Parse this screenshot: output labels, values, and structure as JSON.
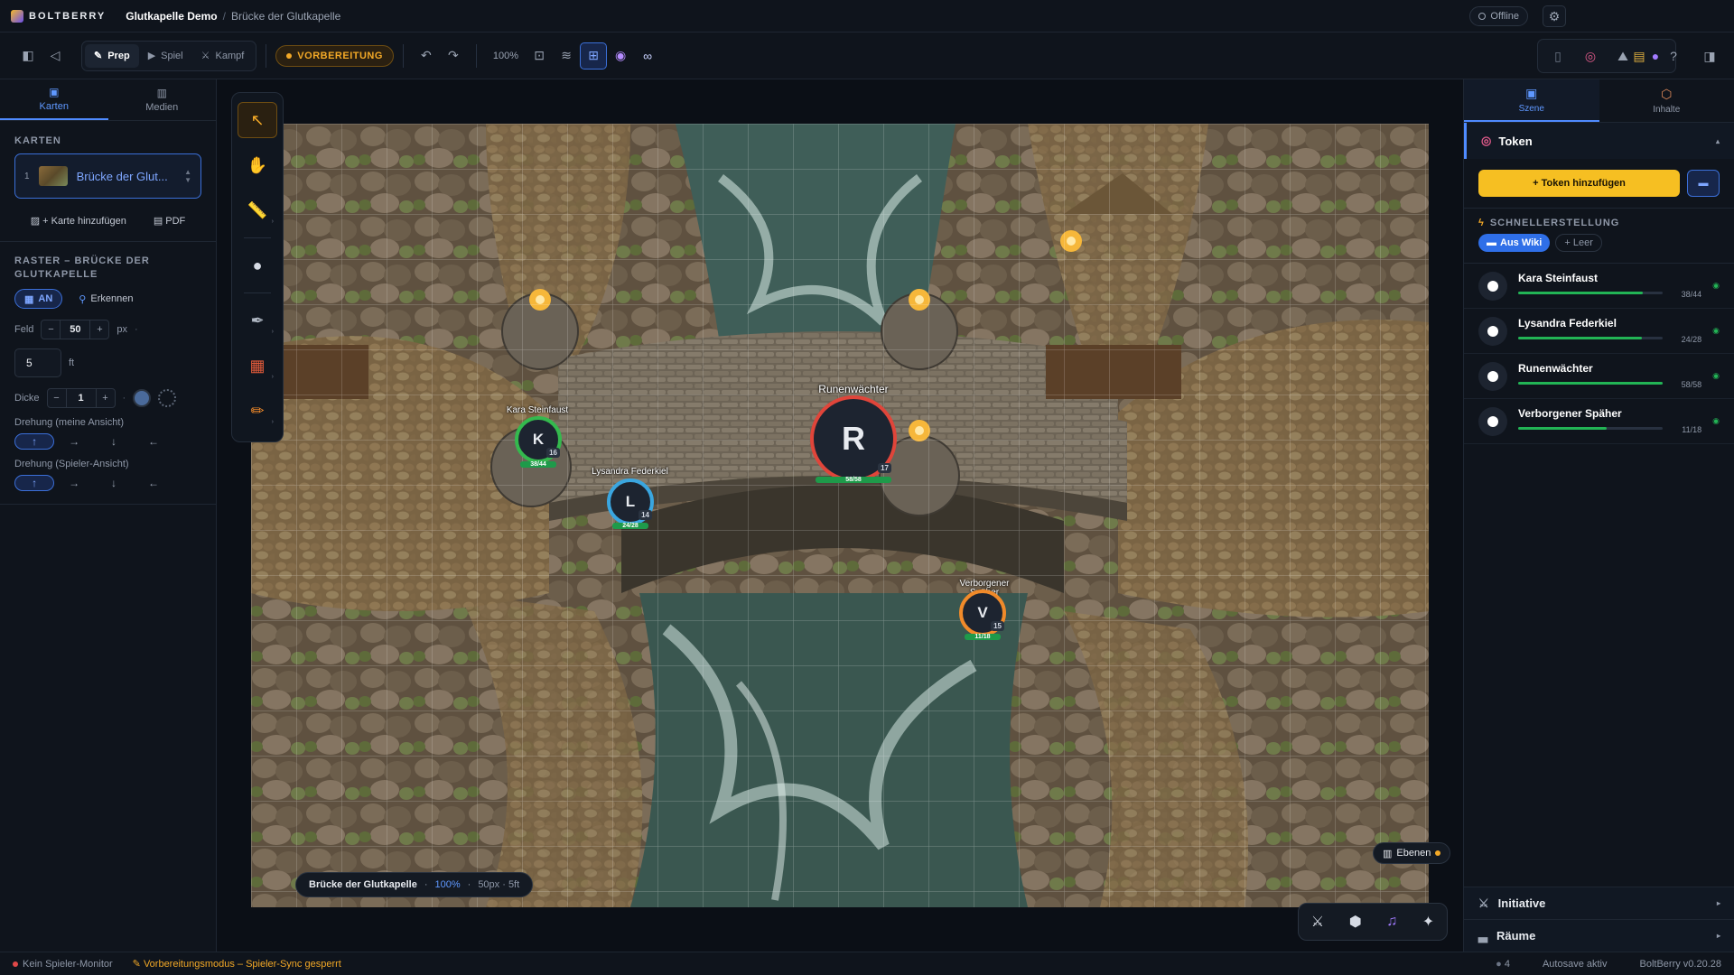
{
  "app": {
    "brand": "BOLTBERRY",
    "project": "Glutkapelle Demo",
    "scene": "Brücke der Glutkapelle",
    "status": "Offline"
  },
  "toolbar": {
    "modes": [
      {
        "label": "Prep",
        "active": true
      },
      {
        "label": "Spiel",
        "active": false
      },
      {
        "label": "Kampf",
        "active": false
      }
    ],
    "phase_badge": "VORBEREITUNG",
    "zoom": "100%"
  },
  "left": {
    "tabs": [
      "Karten",
      "Medien"
    ],
    "maps_title": "KARTEN",
    "map_item": {
      "index": "1",
      "name": "Brücke der Glut..."
    },
    "add_map": "+ Karte hinzufügen",
    "pdf": "PDF",
    "grid_title": "RASTER – BRÜCKE DER GLUTKAPELLE",
    "grid_toggle": "AN",
    "detect": "Erkennen",
    "field_label": "Feld",
    "field_value": "50",
    "field_unit": "px",
    "ft_value": "5",
    "ft_unit": "ft",
    "thickness_label": "Dicke",
    "thickness_value": "1",
    "rotation_mine": "Drehung (meine Ansicht)",
    "rotation_players": "Drehung (Spieler-Ansicht)"
  },
  "stage": {
    "map_label": "Brücke der Glutkapelle",
    "map_zoom": "100%",
    "map_grid": "50px · 5ft",
    "layers": "Ebenen",
    "tokens": [
      {
        "name": "Kara Steinfaust",
        "letter": "K",
        "level": "16",
        "hp": "38/44",
        "ring": "#34b94e"
      },
      {
        "name": "Lysandra Federkiel",
        "letter": "L",
        "level": "14",
        "hp": "24/28",
        "ring": "#3aa6e0"
      },
      {
        "name": "Runenwächter",
        "letter": "R",
        "level": "17",
        "hp": "58/58",
        "ring": "#e0453a"
      },
      {
        "name": "Verborgener Späher",
        "letter": "V",
        "level": "15",
        "hp": "11/18",
        "ring": "#f08a2a"
      }
    ]
  },
  "right": {
    "tabs": [
      "Szene",
      "Inhalte"
    ],
    "section": "Token",
    "add_token": "+ Token hinzufügen",
    "quick_title": "SCHNELLERSTELLUNG",
    "quick_wiki": "Aus Wiki",
    "quick_empty": "+ Leer",
    "tokens": [
      {
        "name": "Kara Steinfaust",
        "hp": "38/44",
        "pct": 0.864
      },
      {
        "name": "Lysandra Federkiel",
        "hp": "24/28",
        "pct": 0.857
      },
      {
        "name": "Runenwächter",
        "hp": "58/58",
        "pct": 1.0
      },
      {
        "name": "Verborgener Späher",
        "hp": "11/18",
        "pct": 0.611
      }
    ],
    "initiative": "Initiative",
    "rooms": "Räume"
  },
  "statusbar": {
    "monitor": "Kein Spieler-Monitor",
    "warning": "Vorbereitungsmodus – Spieler-Sync gesperrt",
    "count": "4",
    "autosave": "Autosave aktiv",
    "version": "BoltBerry v0.20.28"
  }
}
